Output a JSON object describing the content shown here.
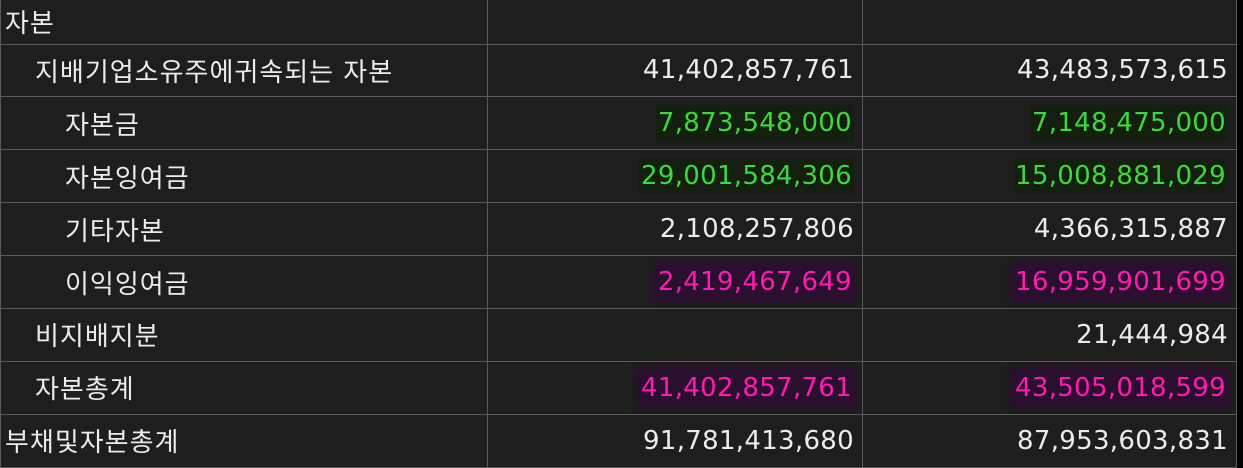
{
  "rows": [
    {
      "label": "자본",
      "v1": "",
      "v2": ""
    },
    {
      "label": "지배기업소유주에귀속되는 자본",
      "v1": "41,402,857,761",
      "v2": "43,483,573,615"
    },
    {
      "label": "자본금",
      "v1": "7,873,548,000",
      "v2": "7,148,475,000"
    },
    {
      "label": "자본잉여금",
      "v1": "29,001,584,306",
      "v2": "15,008,881,029"
    },
    {
      "label": "기타자본",
      "v1": "2,108,257,806",
      "v2": "4,366,315,887"
    },
    {
      "label": "이익잉여금",
      "v1": "2,419,467,649",
      "v2": "16,959,901,699"
    },
    {
      "label": "비지배지분",
      "v1": "",
      "v2": "21,444,984"
    },
    {
      "label": "자본총계",
      "v1": "41,402,857,761",
      "v2": "43,505,018,599"
    },
    {
      "label": "부채및자본총계",
      "v1": "91,781,413,680",
      "v2": "87,953,603,831"
    }
  ],
  "colors": {
    "highlight_green": "#3cd93c",
    "highlight_pink": "#ff1ab0",
    "background": "#1e1e1e",
    "text": "#ececec"
  }
}
